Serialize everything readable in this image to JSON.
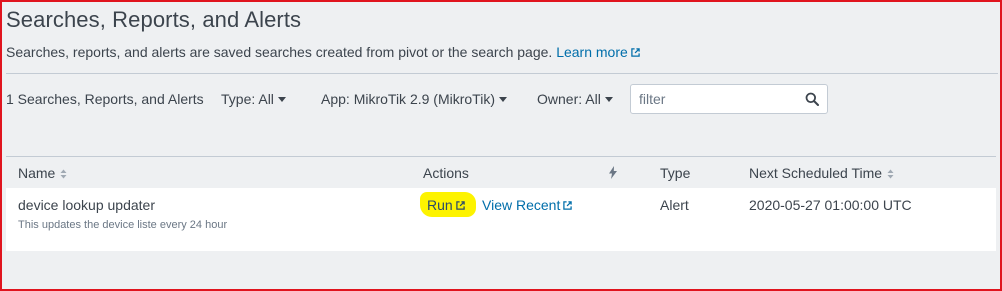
{
  "page": {
    "title": "Searches, Reports, and Alerts",
    "description": "Searches, reports, and alerts are saved searches created from pivot or the search page.",
    "learn_more": "Learn more"
  },
  "filters": {
    "count_label": "1 Searches, Reports, and Alerts",
    "type": "Type: All",
    "app": "App: MikroTik 2.9 (MikroTik)",
    "owner": "Owner: All",
    "search_placeholder": "filter",
    "search_value": ""
  },
  "table": {
    "columns": {
      "name": "Name",
      "actions": "Actions",
      "type": "Type",
      "next_scheduled": "Next Scheduled Time"
    },
    "rows": [
      {
        "name": "device lookup updater",
        "description": "This updates the device liste every 24 hour",
        "run": "Run",
        "view_recent": "View Recent",
        "type": "Alert",
        "next_scheduled": "2020-05-27 01:00:00 UTC"
      }
    ]
  },
  "colors": {
    "link": "#006eaa",
    "highlight": "#fdf300",
    "frame_border": "#e0141e"
  },
  "icons": [
    "external-link-icon",
    "caret-down-icon",
    "search-icon",
    "sort-icon",
    "lightning-icon"
  ]
}
